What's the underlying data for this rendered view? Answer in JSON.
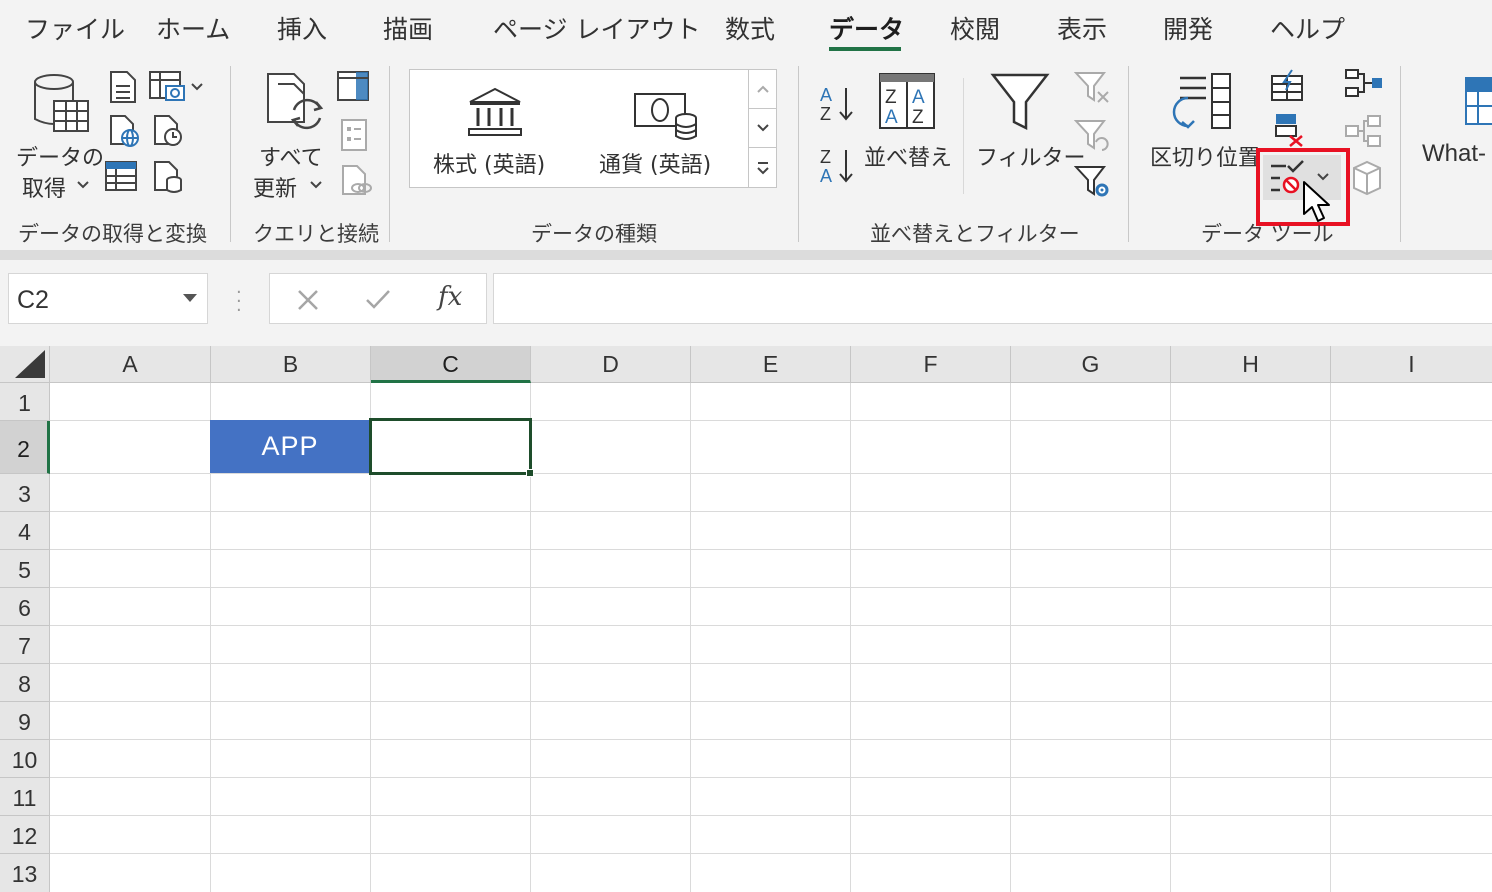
{
  "tabs": {
    "file": "ファイル",
    "home": "ホーム",
    "insert": "挿入",
    "draw": "描画",
    "page_layout": "ページ レイアウト",
    "formulas": "数式",
    "data": "データ",
    "review": "校閲",
    "view": "表示",
    "developer": "開発",
    "help": "ヘルプ"
  },
  "ribbon": {
    "get_data_line1": "データの",
    "get_data_line2": "取得",
    "refresh_line1": "すべて",
    "refresh_line2": "更新",
    "stocks": "株式 (英語)",
    "currencies": "通貨 (英語)",
    "sort": "並べ替え",
    "filter": "フィルター",
    "text_to_columns": "区切り位置",
    "what_if": "What-"
  },
  "groups": {
    "get_transform": "データの取得と変換",
    "queries": "クエリと接続",
    "data_types": "データの種類",
    "sort_filter": "並べ替えとフィルター",
    "data_tools": "データ ツール"
  },
  "formula_bar": {
    "name_box": "C2",
    "fx": "fx",
    "formula": ""
  },
  "sheet": {
    "columns": [
      "A",
      "B",
      "C",
      "D",
      "E",
      "F",
      "G",
      "H",
      "I"
    ],
    "rows": [
      "1",
      "2",
      "3",
      "4",
      "5",
      "6",
      "7",
      "8",
      "9",
      "10",
      "11",
      "12",
      "13"
    ],
    "cell_b2": "APP",
    "cell_c2": ""
  },
  "colors": {
    "accent": "#217346",
    "cell_fill": "#4472c4",
    "highlight": "#e81123"
  }
}
